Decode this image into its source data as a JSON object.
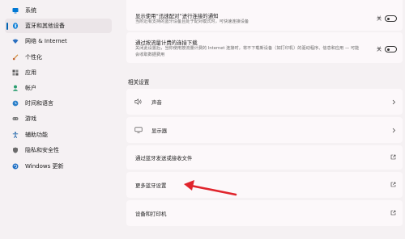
{
  "sidebar": {
    "items": [
      {
        "label": "系统",
        "icon": "monitor-icon"
      },
      {
        "label": "蓝牙和其他设备",
        "icon": "bluetooth-icon",
        "active": true
      },
      {
        "label": "网络 & Internet",
        "icon": "wifi-icon"
      },
      {
        "label": "个性化",
        "icon": "brush-icon"
      },
      {
        "label": "应用",
        "icon": "apps-icon"
      },
      {
        "label": "帐户",
        "icon": "person-icon"
      },
      {
        "label": "时间和语言",
        "icon": "globe-clock-icon"
      },
      {
        "label": "游戏",
        "icon": "gamepad-icon"
      },
      {
        "label": "辅助功能",
        "icon": "accessibility-icon"
      },
      {
        "label": "隐私和安全性",
        "icon": "shield-icon"
      },
      {
        "label": "Windows 更新",
        "icon": "update-icon"
      }
    ]
  },
  "main": {
    "top_settings": [
      {
        "title": "显示使用“迅速配对”进行连接的通知",
        "desc_lines": [
          "当附近有支持的蓝牙设备且处于配对模式时，可快速连接设备"
        ],
        "toggle_label": "关",
        "toggle_on": false
      },
      {
        "title": "通过按流量计费的连接下载",
        "desc_lines": [
          "关闭此设置后，当你使用按流量计费的 Internet 连接时，将不下载新设备（如打印机）的驱动程序、信息和应用 — 可能",
          "会收取数据费用"
        ],
        "toggle_label": "关",
        "toggle_on": false
      }
    ],
    "related_title": "相关设置",
    "related_items": [
      {
        "label": "声音",
        "icon": "speaker-icon",
        "trail": "chevron"
      },
      {
        "label": "显示器",
        "icon": "monitor-icon",
        "trail": "chevron"
      },
      {
        "label": "通过蓝牙发送或接收文件",
        "trail": "external"
      },
      {
        "label": "更多蓝牙设置",
        "trail": "external"
      },
      {
        "label": "设备和打印机",
        "trail": "external"
      }
    ]
  },
  "colors": {
    "accent": "#0063b1",
    "annotation_arrow": "#e0242c",
    "background": "#f5f1f3",
    "card": "#fcf8fa"
  }
}
